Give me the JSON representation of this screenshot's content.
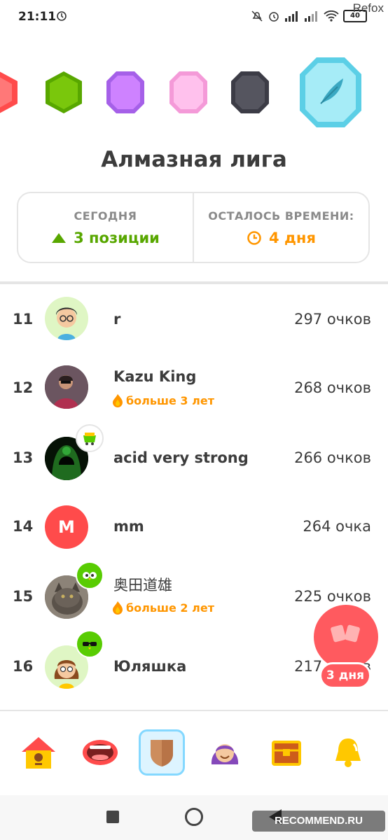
{
  "status_bar": {
    "time": "21:11",
    "battery": "40"
  },
  "watermark_top": "Refox",
  "watermark_bottom": "RECOMMEND.RU",
  "league": {
    "title": "Алмазная лига",
    "badges": [
      "ruby-league-badge",
      "emerald-league-badge",
      "amethyst-league-badge",
      "pearl-league-badge",
      "obsidian-league-badge",
      "diamond-league-badge"
    ]
  },
  "info": {
    "today_label": "СЕГОДНЯ",
    "today_value": "3 позиции",
    "time_label": "ОСТАЛОСЬ ВРЕМЕНИ:",
    "time_value": "4 дня"
  },
  "leaderboard": [
    {
      "rank": "11",
      "name": "r",
      "streak": "",
      "points": "297 очков",
      "avatar": "boy-avatar"
    },
    {
      "rank": "12",
      "name": "Kazu King",
      "streak": "больше 3 лет",
      "points": "268 очков",
      "avatar": "photo-avatar"
    },
    {
      "rank": "13",
      "name": "acid very strong",
      "streak": "",
      "points": "266 очков",
      "avatar": "hooded-figure-avatar"
    },
    {
      "rank": "14",
      "name": "mm",
      "streak": "",
      "points": "264 очка",
      "avatar": "letter-avatar",
      "initial": "M"
    },
    {
      "rank": "15",
      "name": "奥田道雄",
      "streak": "больше 2 лет",
      "points": "225 очков",
      "avatar": "cat-photo-avatar"
    },
    {
      "rank": "16",
      "name": "Юляшка",
      "streak": "",
      "points": "217 очков",
      "avatar": "girl-avatar"
    }
  ],
  "chest_button": {
    "label": "3 дня"
  },
  "nav": [
    "home-icon",
    "speaking-icon",
    "league-shield-icon",
    "profile-icon",
    "chest-icon",
    "notifications-icon"
  ],
  "colors": {
    "green": "#58a700",
    "orange": "#ff9600",
    "red": "#ff5a5f",
    "active_blue": "#84d8ff"
  }
}
